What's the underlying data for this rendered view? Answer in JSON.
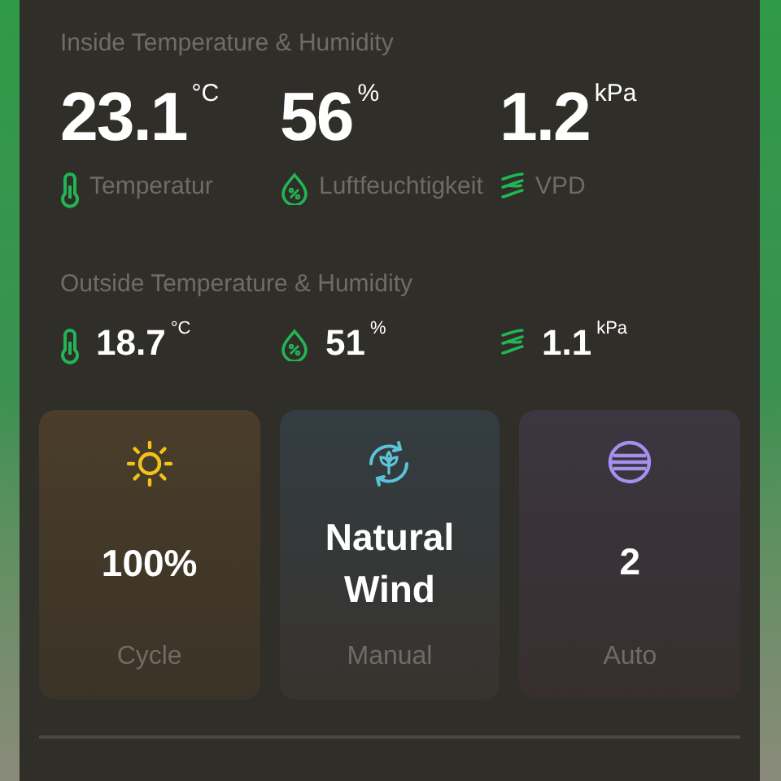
{
  "inside": {
    "title": "Inside Temperature & Humidity",
    "metrics": [
      {
        "kind": "temperature",
        "value": "23.1",
        "unit": "°C",
        "label": "Temperatur"
      },
      {
        "kind": "humidity",
        "value": "56",
        "unit": "%",
        "label": "Luftfeuchtigkeit"
      },
      {
        "kind": "vpd",
        "value": "1.2",
        "unit": "kPa",
        "label": "VPD"
      }
    ]
  },
  "outside": {
    "title": "Outside Temperature & Humidity",
    "metrics": [
      {
        "kind": "temperature",
        "value": "18.7",
        "unit": "°C"
      },
      {
        "kind": "humidity",
        "value": "51",
        "unit": "%"
      },
      {
        "kind": "vpd",
        "value": "1.1",
        "unit": "kPa"
      }
    ]
  },
  "modes": [
    {
      "kind": "light",
      "value": "100%",
      "label": "Cycle"
    },
    {
      "kind": "wind",
      "value": "Natural Wind",
      "label": "Manual"
    },
    {
      "kind": "fan",
      "value": "2",
      "label": "Auto"
    }
  ]
}
